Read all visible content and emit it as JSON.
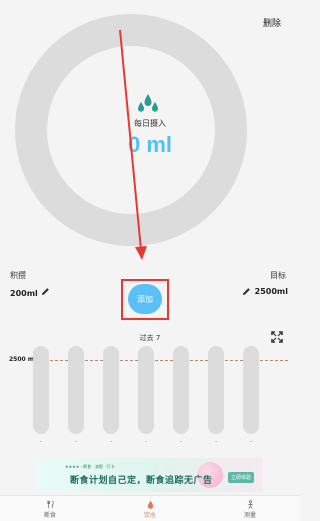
{
  "header": {
    "delete_label": "删除"
  },
  "ring": {
    "daily_label": "每日摄入",
    "daily_value": "0 ml",
    "progress": 0
  },
  "stats": {
    "left_label": "积攒",
    "left_value": "200ml",
    "right_label": "目标",
    "right_value": "2500ml"
  },
  "add_button": {
    "label": "添加"
  },
  "history": {
    "title": "过去 7",
    "target_label": "2500 ml",
    "bars": [
      {
        "tick": "-",
        "value": 0
      },
      {
        "tick": "-",
        "value": 0
      },
      {
        "tick": "-",
        "value": 0
      },
      {
        "tick": "-",
        "value": 0
      },
      {
        "tick": "-",
        "value": 0
      },
      {
        "tick": "-",
        "value": 0
      },
      {
        "tick": "-",
        "value": 0
      }
    ]
  },
  "ad": {
    "top_text": "★★★★ · 断食 · 减肥 · 打卡",
    "main_text": "断食计划自己定，断食追踪无广告",
    "cta": "立即体验"
  },
  "tabs": [
    {
      "label": "断食",
      "icon": "fork-knife-icon",
      "active": false
    },
    {
      "label": "饮水",
      "icon": "drop-icon",
      "active": true
    },
    {
      "label": "测量",
      "icon": "person-icon",
      "active": false
    }
  ],
  "colors": {
    "accent": "#5bc0f8",
    "highlight": "#e53935",
    "active_tab": "#e07a5f",
    "ring": "#dcdcdc"
  }
}
